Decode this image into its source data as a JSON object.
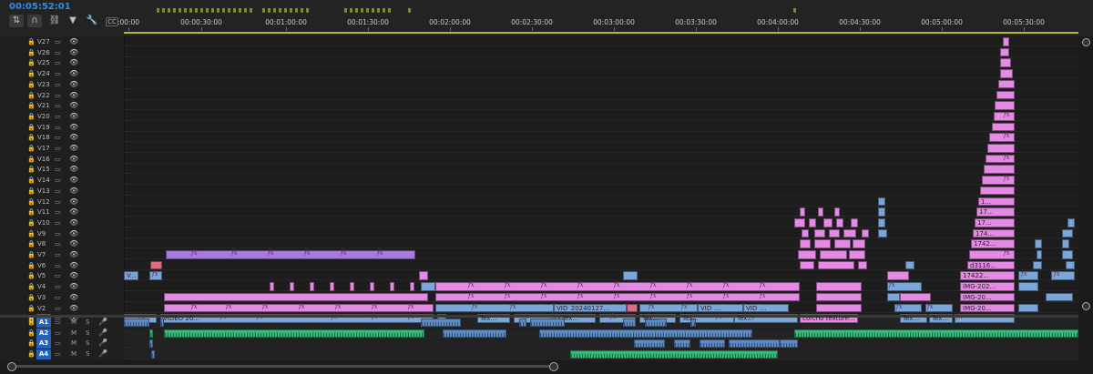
{
  "timecode": "00:05:52:01",
  "toolbar": {
    "icons": [
      "nest-sequences-icon",
      "snap-icon",
      "linked-selection-icon",
      "add-marker-icon",
      "settings-wrench-icon",
      "captions-icon"
    ],
    "glyphs": [
      "⇅",
      "∩",
      "⛓",
      "▼",
      "🔧",
      "CC"
    ]
  },
  "ruler": {
    "ticks": [
      ":00:00",
      "00:00:30:00",
      "00:01:00:00",
      "00:01:30:00",
      "00:02:00:00",
      "00:02:30:00",
      "00:03:00:00",
      "00:03:30:00",
      "00:04:00:00",
      "00:04:30:00",
      "00:05:00:00",
      "00:05:30:00"
    ]
  },
  "video_tracks": [
    "V27",
    "V26",
    "V25",
    "V24",
    "V23",
    "V22",
    "V21",
    "V20",
    "V19",
    "V18",
    "V17",
    "V16",
    "V15",
    "V14",
    "V13",
    "V12",
    "V11",
    "V10",
    "V9",
    "V8",
    "V7",
    "V6",
    "V5",
    "V4",
    "V3",
    "V2",
    "V1"
  ],
  "audio_tracks": [
    "A1",
    "A2",
    "A3",
    "A4"
  ],
  "audio_buttons": {
    "mute": "M",
    "solo": "S"
  },
  "fx_label": "fx",
  "clip_labels": {
    "video20": "VIDEO 20...",
    "vid20240127": "VID_20240127...",
    "vid1": "VID_...",
    "vid2": "VID_...",
    "tex": "Tex...",
    "corcho": "corcho texture...",
    "v5short": "V...",
    "img1": "IMG-20...",
    "img2": "IMG-20...",
    "img3": "IMG-202...",
    "n17422": "17422...",
    "d3116": "d3116...",
    "n1742": "1742...",
    "n174": "174...",
    "n17a": "17...",
    "n17b": "17...",
    "n1": "1..."
  },
  "colors": {
    "timecode": "#2d8ceb",
    "clip_pink": "#e48ae4",
    "clip_purple": "#a77bdc",
    "clip_blue": "#7ba6d9",
    "clip_red": "#e06b8b",
    "audio_green": "#38b77a",
    "audio_blue": "#5d89c4",
    "target_track": "#2461b8"
  }
}
